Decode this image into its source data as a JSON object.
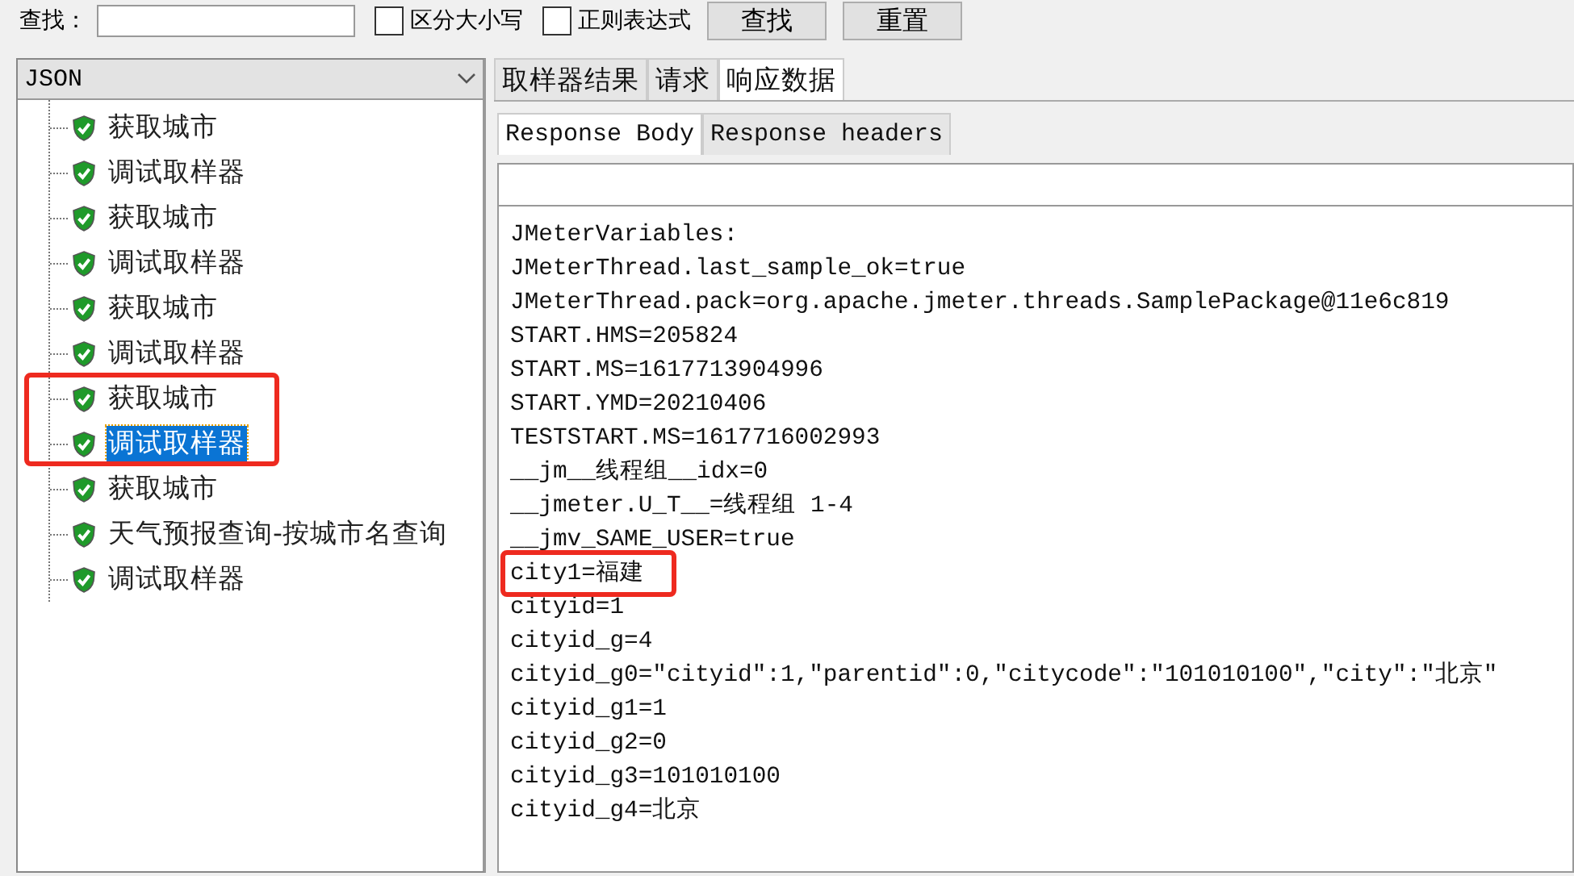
{
  "search_bar": {
    "label": "查找：",
    "options": [
      {
        "label": "区分大小写",
        "checked": false
      },
      {
        "label": "正则表达式",
        "checked": false
      }
    ],
    "buttons": [
      "查找",
      "重置"
    ]
  },
  "renderer": {
    "value": "JSON"
  },
  "tree": {
    "items": [
      {
        "label": "获取城市",
        "selected": false,
        "annotated": false
      },
      {
        "label": "调试取样器",
        "selected": false,
        "annotated": false
      },
      {
        "label": "获取城市",
        "selected": false,
        "annotated": false
      },
      {
        "label": "调试取样器",
        "selected": false,
        "annotated": false
      },
      {
        "label": "获取城市",
        "selected": false,
        "annotated": false
      },
      {
        "label": "调试取样器",
        "selected": false,
        "annotated": false
      },
      {
        "label": "获取城市",
        "selected": false,
        "annotated": true
      },
      {
        "label": "调试取样器",
        "selected": true,
        "annotated": true
      },
      {
        "label": "获取城市",
        "selected": false,
        "annotated": false
      },
      {
        "label": "天气预报查询-按城市名查询",
        "selected": false,
        "annotated": false
      },
      {
        "label": "调试取样器",
        "selected": false,
        "annotated": false
      }
    ]
  },
  "tabs": [
    {
      "label": "取样器结果",
      "selected": false
    },
    {
      "label": "请求",
      "selected": false
    },
    {
      "label": "响应数据",
      "selected": true
    }
  ],
  "sub_tabs": [
    {
      "label": "Response Body",
      "selected": true
    },
    {
      "label": "Response headers",
      "selected": false
    }
  ],
  "response_lines": [
    {
      "text": "JMeterVariables:",
      "annotated": false
    },
    {
      "text": "JMeterThread.last_sample_ok=true",
      "annotated": false
    },
    {
      "text": "JMeterThread.pack=org.apache.jmeter.threads.SamplePackage@11e6c819",
      "annotated": false
    },
    {
      "text": "START.HMS=205824",
      "annotated": false
    },
    {
      "text": "START.MS=1617713904996",
      "annotated": false
    },
    {
      "text": "START.YMD=20210406",
      "annotated": false
    },
    {
      "text": "TESTSTART.MS=1617716002993",
      "annotated": false
    },
    {
      "text": "__jm__线程组__idx=0",
      "annotated": false
    },
    {
      "text": "__jmeter.U_T__=线程组 1-4",
      "annotated": false
    },
    {
      "text": "__jmv_SAME_USER=true",
      "annotated": false
    },
    {
      "text": "city1=福建",
      "annotated": true
    },
    {
      "text": "cityid=1",
      "annotated": false
    },
    {
      "text": "cityid_g=4",
      "annotated": false
    },
    {
      "text": "cityid_g0=\"cityid\":1,\"parentid\":0,\"citycode\":\"101010100\",\"city\":\"北京\"",
      "annotated": false
    },
    {
      "text": "cityid_g1=1",
      "annotated": false
    },
    {
      "text": "cityid_g2=0",
      "annotated": false
    },
    {
      "text": "cityid_g3=101010100",
      "annotated": false
    },
    {
      "text": "cityid_g4=北京",
      "annotated": false
    }
  ]
}
